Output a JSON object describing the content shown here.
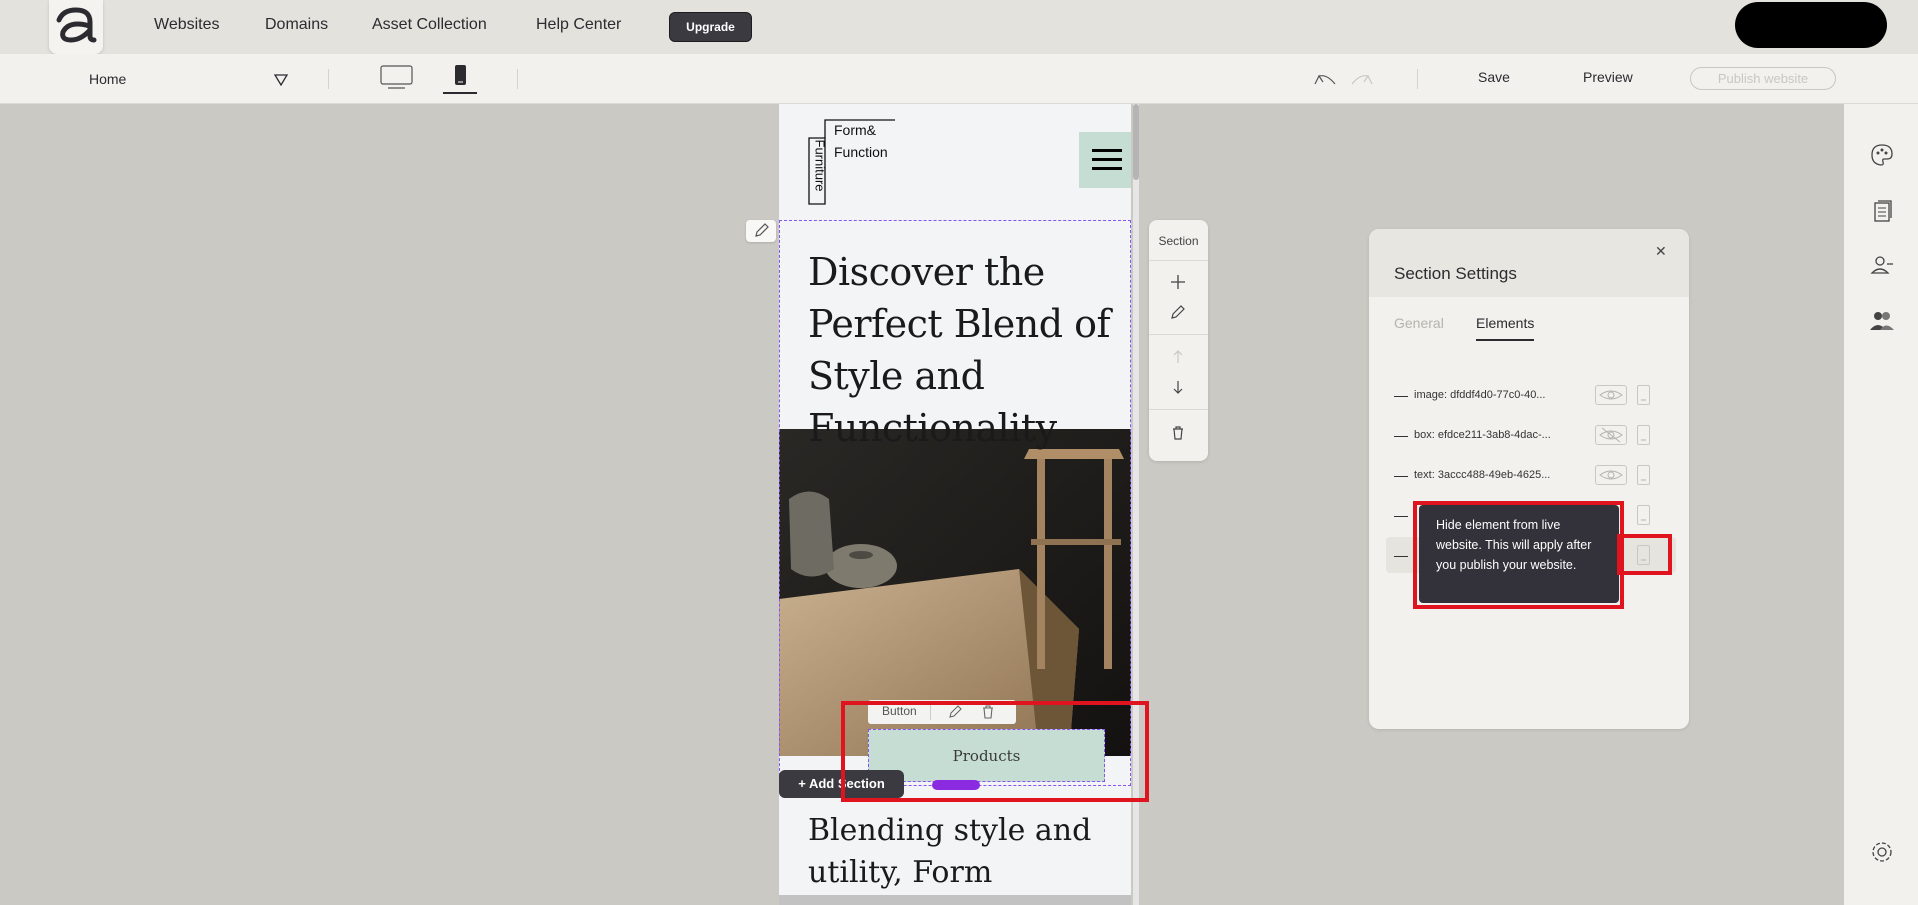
{
  "nav": {
    "links": [
      "Websites",
      "Domains",
      "Asset Collection",
      "Help Center"
    ],
    "upgrade_label": "Upgrade"
  },
  "toolbar": {
    "page_select": "Home",
    "save_label": "Save",
    "preview_label": "Preview",
    "publish_label": "Publish website"
  },
  "canvas": {
    "brand_top": "Form&",
    "brand_mid": "Function",
    "brand_side": "Furniture",
    "hero_title": "Discover the Perfect Blend of Style and Functionality",
    "next_title": "Blending style and utility, Form",
    "button_toolbar_label": "Button",
    "products_label": "Products",
    "add_section_label": "+ Add Section"
  },
  "section_tools": {
    "title": "Section"
  },
  "settings": {
    "title": "Section Settings",
    "tabs": [
      "General",
      "Elements"
    ],
    "elements": [
      {
        "label": "image: dfddf4d0-77c0-40...",
        "visible": true
      },
      {
        "label": "box: efdce211-3ab8-4dac-...",
        "visible": false
      },
      {
        "label": "text: 3accc488-49eb-4625...",
        "visible": true
      },
      {
        "label": "",
        "visible": true
      },
      {
        "label": "",
        "visible": true
      }
    ],
    "tooltip": "Hide element from live website. This will apply after you publish your website."
  },
  "colors": {
    "accent_purple": "#8a52f0",
    "highlight_red": "#e0141e",
    "button_mint": "#c6ddd3",
    "dark": "#3a3a40"
  }
}
